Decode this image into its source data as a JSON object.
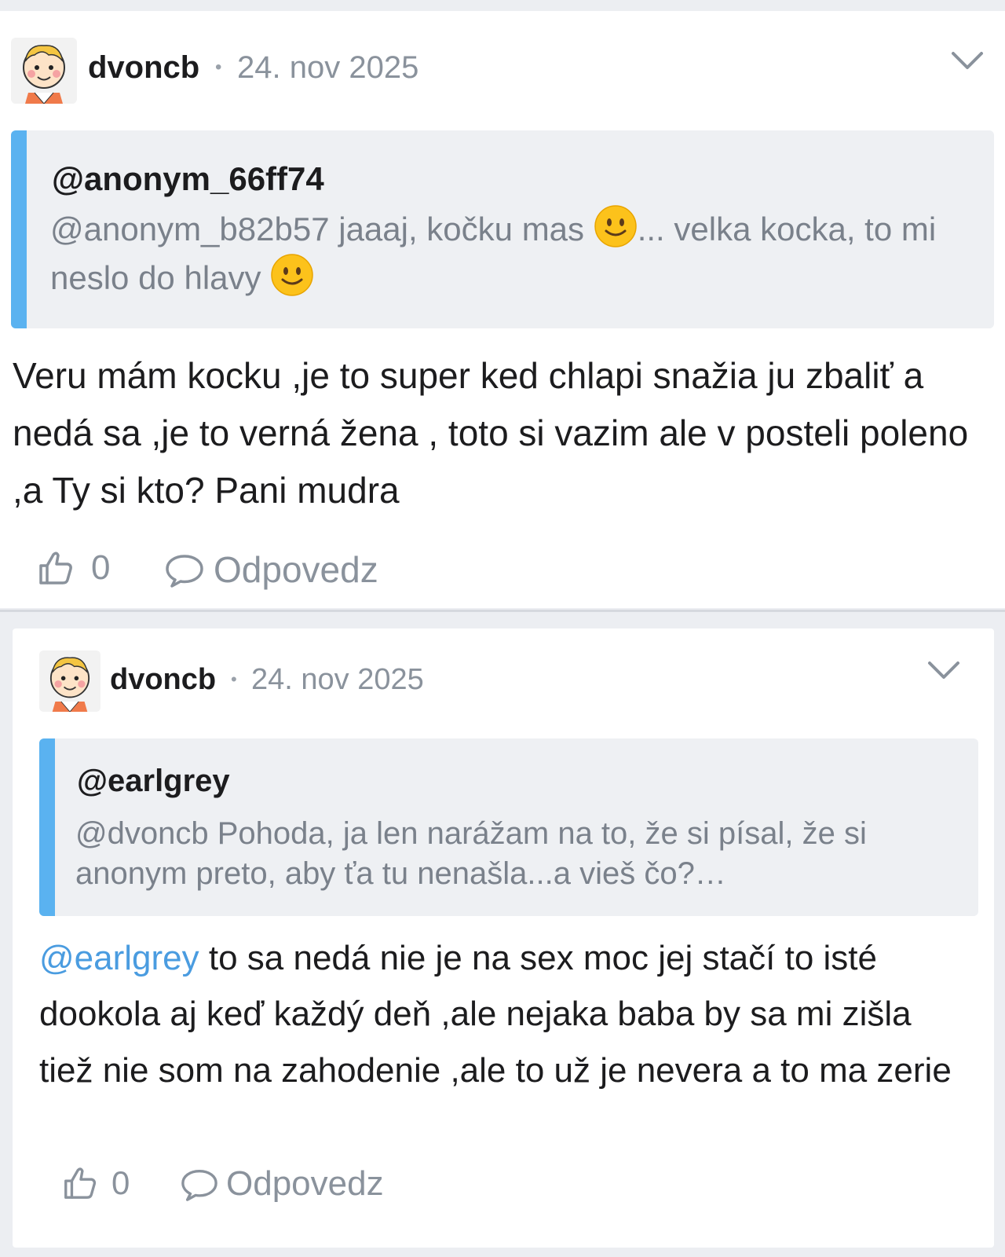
{
  "posts": [
    {
      "author": "dvoncb",
      "separator": "•",
      "date": "24. nov 2025",
      "quote": {
        "author": "@anonym_66ff74",
        "text_part1": "@anonym_b82b57 jaaaj, kočku mas ",
        "text_part2": "... velka kocka, to mi neslo do hlavy ",
        "emoji": "slightly-smiling-face"
      },
      "body": "Veru mám kocku ,je to super ked chlapi snažia ju zbaliť a nedá sa ,je to verná žena , toto si vazim ale v posteli poleno ,a Ty si kto? Pani mudra",
      "likes": "0",
      "reply_label": "Odpovedz"
    },
    {
      "author": "dvoncb",
      "separator": "•",
      "date": "24. nov 2025",
      "quote": {
        "author": "@earlgrey",
        "text": "@dvoncb Pohoda, ja len narážam na to, že si písal, že si anonym preto, aby ťa tu nenašla...a vieš čo?…"
      },
      "body_mention": "@earlgrey",
      "body": " to sa nedá nie je na sex moc jej stačí to isté dookola aj keď každý deň ,ale nejaka baba by sa mi zišla tiež nie som na zahodenie ,ale to už je nevera a to ma zerie",
      "likes": "0",
      "reply_label": "Odpovedz"
    }
  ],
  "icons": {
    "menu": "chevron-down-icon",
    "like": "thumbs-up-icon",
    "reply": "speech-bubble-icon",
    "avatar": "cartoon-child-avatar"
  },
  "colors": {
    "accent_quote_bar": "#5ab2f0",
    "mention": "#4a9ce0",
    "muted_text": "#8a929c",
    "quote_bg": "#eef0f3",
    "page_bg": "#eceef2"
  }
}
